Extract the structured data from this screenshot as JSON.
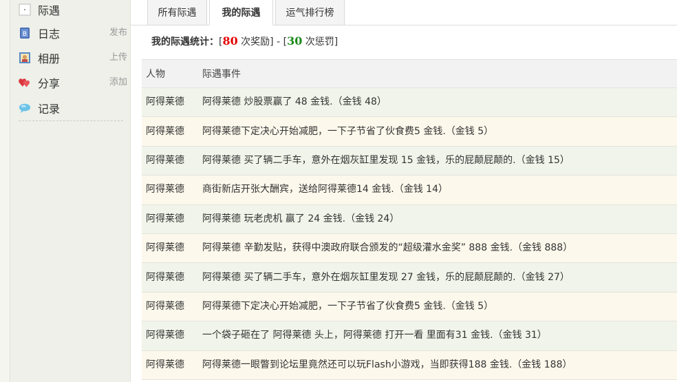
{
  "sidebar": {
    "items": [
      {
        "label": "际遇",
        "icon": "encounter-icon",
        "action": ""
      },
      {
        "label": "日志",
        "icon": "journal-icon",
        "action": "发布"
      },
      {
        "label": "相册",
        "icon": "album-icon",
        "action": "上传"
      },
      {
        "label": "分享",
        "icon": "share-hearts-icon",
        "action": "添加"
      },
      {
        "label": "记录",
        "icon": "speech-bubble-icon",
        "action": ""
      }
    ]
  },
  "tabs": [
    {
      "label": "所有际遇",
      "active": false
    },
    {
      "label": "我的际遇",
      "active": true
    },
    {
      "label": "运气排行榜",
      "active": false
    }
  ],
  "stats": {
    "label": "我的际遇统计：",
    "open1": "[",
    "reward_count": "80",
    "reward_text": " 次奖励]",
    "sep": " - ",
    "open2": "[",
    "penalty_count": "30",
    "penalty_text": " 次惩罚]"
  },
  "table": {
    "columns": [
      "人物",
      "际遇事件"
    ],
    "rows": [
      {
        "person": "阿得莱德",
        "event": "阿得莱德 炒股票赢了 48 金钱.（金钱 48）"
      },
      {
        "person": "阿得莱德",
        "event": "阿得莱德下定决心开始减肥，一下子节省了伙食费5 金钱.（金钱 5）"
      },
      {
        "person": "阿得莱德",
        "event": "阿得莱德 买了辆二手车，意外在烟灰缸里发现 15 金钱，乐的屁颠屁颠的.（金钱 15）"
      },
      {
        "person": "阿得莱德",
        "event": "商街新店开张大酬宾，送给阿得莱德14 金钱.（金钱 14）"
      },
      {
        "person": "阿得莱德",
        "event": "阿得莱德 玩老虎机 赢了 24 金钱.（金钱 24）"
      },
      {
        "person": "阿得莱德",
        "event": "阿得莱德 辛勤发贴，获得中澳政府联合颁发的“超级灌水金奖” 888 金钱.（金钱 888）"
      },
      {
        "person": "阿得莱德",
        "event": "阿得莱德 买了辆二手车，意外在烟灰缸里发现 27 金钱，乐的屁颠屁颠的.（金钱 27）"
      },
      {
        "person": "阿得莱德",
        "event": "阿得莱德下定决心开始减肥，一下子节省了伙食费5 金钱.（金钱 5）"
      },
      {
        "person": "阿得莱德",
        "event": "一个袋子砸在了 阿得莱德 头上，阿得莱德 打开一看 里面有31 金钱.（金钱 31）"
      },
      {
        "person": "阿得莱德",
        "event": "阿得莱德一眼瞥到论坛里竟然还可以玩Flash小游戏，当即获得188 金钱.（金钱 188）"
      }
    ]
  }
}
